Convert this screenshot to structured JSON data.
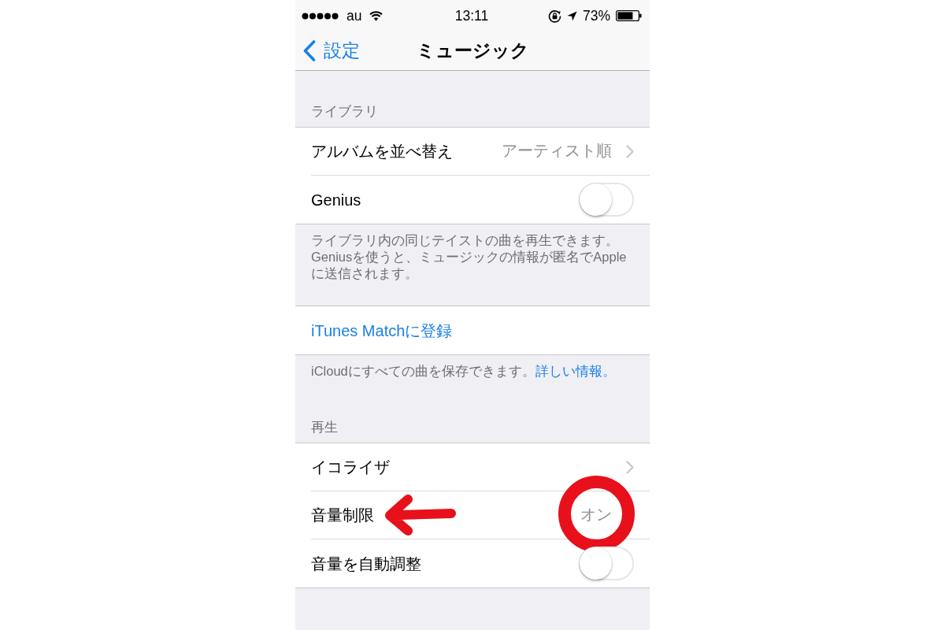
{
  "status_bar": {
    "carrier": "au",
    "time": "13:11",
    "battery": "73%"
  },
  "nav_bar": {
    "back": "設定",
    "title": "ミュージック"
  },
  "sections": [
    {
      "header": "ライブラリ",
      "rows": [
        {
          "kind": "disclosure",
          "label": "アルバムを並べ替え",
          "value": "アーティスト順"
        },
        {
          "kind": "toggle",
          "label": "Genius",
          "on": false
        }
      ],
      "footer": {
        "text": "ライブラリ内の同じテイストの曲を再生できます。\nGeniusを使うと、ミュージックの情報が匿名でApple\nに送信されます。"
      }
    },
    {
      "rows": [
        {
          "kind": "action",
          "label": "iTunes Matchに登録"
        }
      ],
      "footer": {
        "text": "iCloudにすべての曲を保存できます。",
        "link": "詳しい情報。"
      }
    },
    {
      "header": "再生",
      "rows": [
        {
          "kind": "disclosure",
          "label": "イコライザ"
        },
        {
          "kind": "value",
          "label": "音量制限",
          "value": "オン",
          "pointer_arrow": true,
          "value_circled": true
        },
        {
          "kind": "toggle",
          "label": "音量を自動調整",
          "on": false
        }
      ]
    }
  ]
}
